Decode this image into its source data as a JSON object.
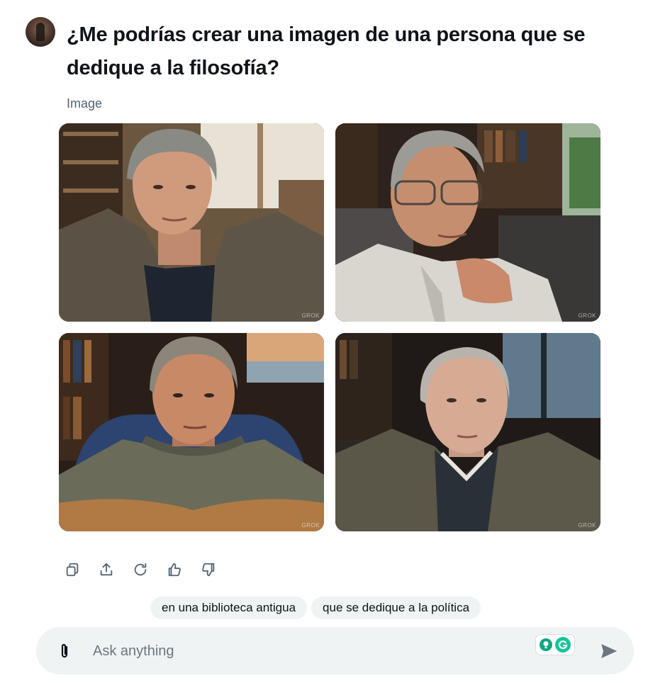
{
  "prompt": {
    "text": "¿Me podrías crear una imagen de una persona que se dedique a la filosofía?",
    "avatar_icon": "user-avatar"
  },
  "result": {
    "label": "Image",
    "images": [
      {
        "subject": "middle-aged man with grey hair in tweed jacket, library background",
        "watermark": "GROK"
      },
      {
        "subject": "elderly man with glasses, hand on chin, bookshelves",
        "watermark": "GROK"
      },
      {
        "subject": "man in knit sweater in blue armchair, sunset window",
        "watermark": "GROK"
      },
      {
        "subject": "elderly balding man in tweed jacket, dark library",
        "watermark": "GROK"
      }
    ]
  },
  "actions": [
    {
      "icon": "copy-icon"
    },
    {
      "icon": "share-icon"
    },
    {
      "icon": "regenerate-icon"
    },
    {
      "icon": "thumbs-up-icon"
    },
    {
      "icon": "thumbs-down-icon"
    }
  ],
  "suggestions": [
    "en una biblioteca antigua",
    "que se dedique a la política"
  ],
  "composer": {
    "placeholder": "Ask anything",
    "attach_icon": "paperclip-icon",
    "send_icon": "send-icon",
    "extension_icons": [
      "lightbulb-extension-icon",
      "grammarly-icon"
    ]
  },
  "colors": {
    "text_primary": "#0f1419",
    "text_secondary": "#536471",
    "chip_bg": "#eff3f4",
    "composer_bg": "#eff3f4",
    "grammarly_green": "#15c39a"
  }
}
